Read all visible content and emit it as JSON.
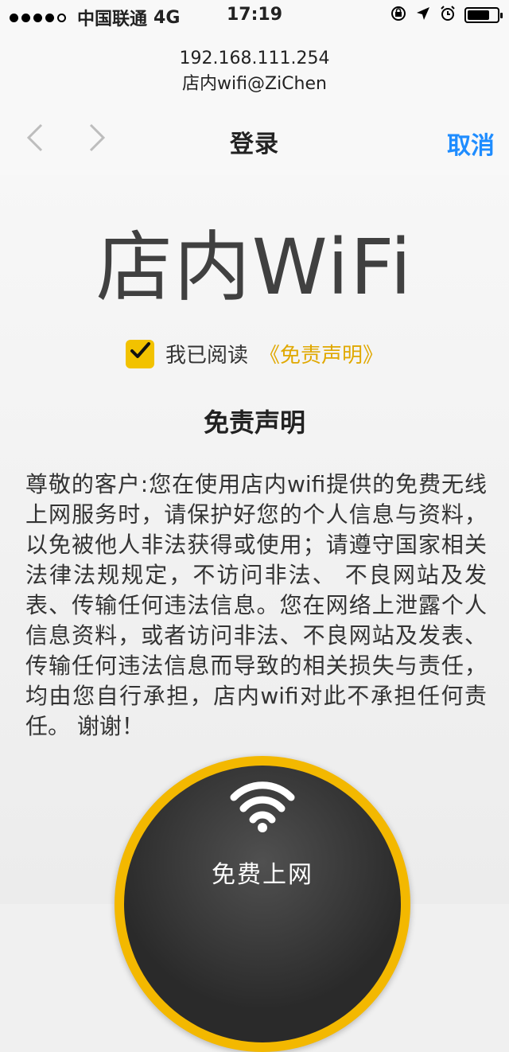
{
  "status_bar": {
    "carrier": "中国联通",
    "network": "4G",
    "time": "17:19",
    "battery_level": 0.75
  },
  "portal": {
    "ip": "192.168.111.254",
    "ssid": "店内wifi@ZiChen",
    "title": "登录",
    "cancel_label": "取消"
  },
  "content": {
    "brand_title": "店内WiFi",
    "agree_text": "我已阅读",
    "agree_link": "《免责声明》",
    "disclaimer_heading": "免责声明",
    "disclaimer_body": "尊敬的客户:您在使用店内wifi提供的免费无线上网服务时，请保护好您的个人信息与资料，以免被他人非法获得或使用；请遵守国家相关法律法规规定，不访问非法、 不良网站及发表、传输任何违法信息。您在网络上泄露个人信息资料，或者访问非法、不良网站及发表、传输任何违法信息而导致的相关损失与责任，均由您自行承担，店内wifi对此不承担任何责任。 谢谢！",
    "connect_label": "免费上网"
  },
  "icons": {
    "back": "chevron-left-icon",
    "forward": "chevron-right-icon",
    "checkbox": "checkmark-icon",
    "wifi": "wifi-icon",
    "lock_rotation": "lock-rotation-icon",
    "location": "location-arrow-icon",
    "alarm": "alarm-icon"
  },
  "colors": {
    "accent_blue": "#1e8cff",
    "accent_yellow": "#f2c200",
    "link_yellow": "#e0a800"
  }
}
